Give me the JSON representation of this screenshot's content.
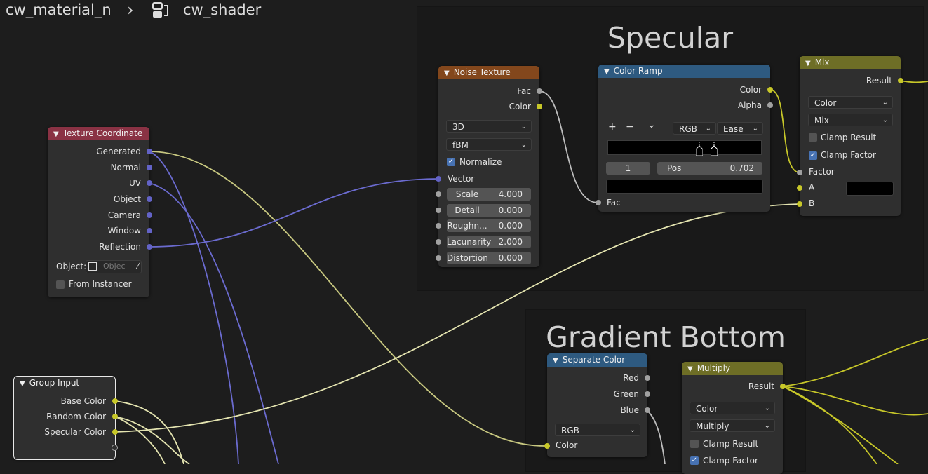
{
  "breadcrumb": {
    "material": "cw_material_n",
    "separator": "›",
    "group": "cw_shader"
  },
  "frames": [
    {
      "title": "Specular"
    },
    {
      "title": "Gradient Bottom"
    }
  ],
  "texture_coordinate": {
    "title": "Texture Coordinate",
    "outputs": [
      "Generated",
      "Normal",
      "UV",
      "Object",
      "Camera",
      "Window",
      "Reflection"
    ],
    "object_label": "Object:",
    "object_placeholder": "Objec",
    "from_instancer": "From Instancer",
    "color": "#8a3244"
  },
  "group_input": {
    "title": "Group Input",
    "outputs": [
      "Base Color",
      "Random Color",
      "Specular Color"
    ]
  },
  "noise_texture": {
    "title": "Noise Texture",
    "outputs": [
      "Fac",
      "Color"
    ],
    "dimension": "3D",
    "noise_type": "fBM",
    "normalize": "Normalize",
    "vector": "Vector",
    "inputs": [
      {
        "label": "Scale",
        "value": "4.000"
      },
      {
        "label": "Detail",
        "value": "0.000"
      },
      {
        "label": "Roughn...",
        "value": "0.000"
      },
      {
        "label": "Lacunarity",
        "value": "2.000"
      },
      {
        "label": "Distortion",
        "value": "0.000"
      }
    ],
    "color": "#83471c"
  },
  "color_ramp": {
    "title": "Color Ramp",
    "outputs": [
      "Color",
      "Alpha"
    ],
    "add": "+",
    "remove": "−",
    "menu": "⌄",
    "mode": "RGB",
    "interp": "Ease",
    "index": "1",
    "pos_label": "Pos",
    "pos_value": "0.702",
    "input": "Fac",
    "color": "#2e5a80"
  },
  "mix": {
    "title": "Mix",
    "output": "Result",
    "data_type": "Color",
    "blend": "Mix",
    "clamp_result": "Clamp Result",
    "clamp_factor": "Clamp Factor",
    "inputs": [
      "Factor",
      "A",
      "B"
    ],
    "color": "#6e6e26"
  },
  "separate_color": {
    "title": "Separate Color",
    "outputs": [
      "Red",
      "Green",
      "Blue"
    ],
    "mode": "RGB",
    "input": "Color",
    "color": "#2e5a80"
  },
  "multiply": {
    "title": "Multiply",
    "output": "Result",
    "data_type": "Color",
    "blend": "Multiply",
    "clamp_result": "Clamp Result",
    "clamp_factor": "Clamp Factor",
    "color": "#6e6e26"
  },
  "colors": {
    "vector_socket": "#6363c7",
    "color_socket": "#c7c729",
    "float_socket": "#a1a1a1"
  }
}
